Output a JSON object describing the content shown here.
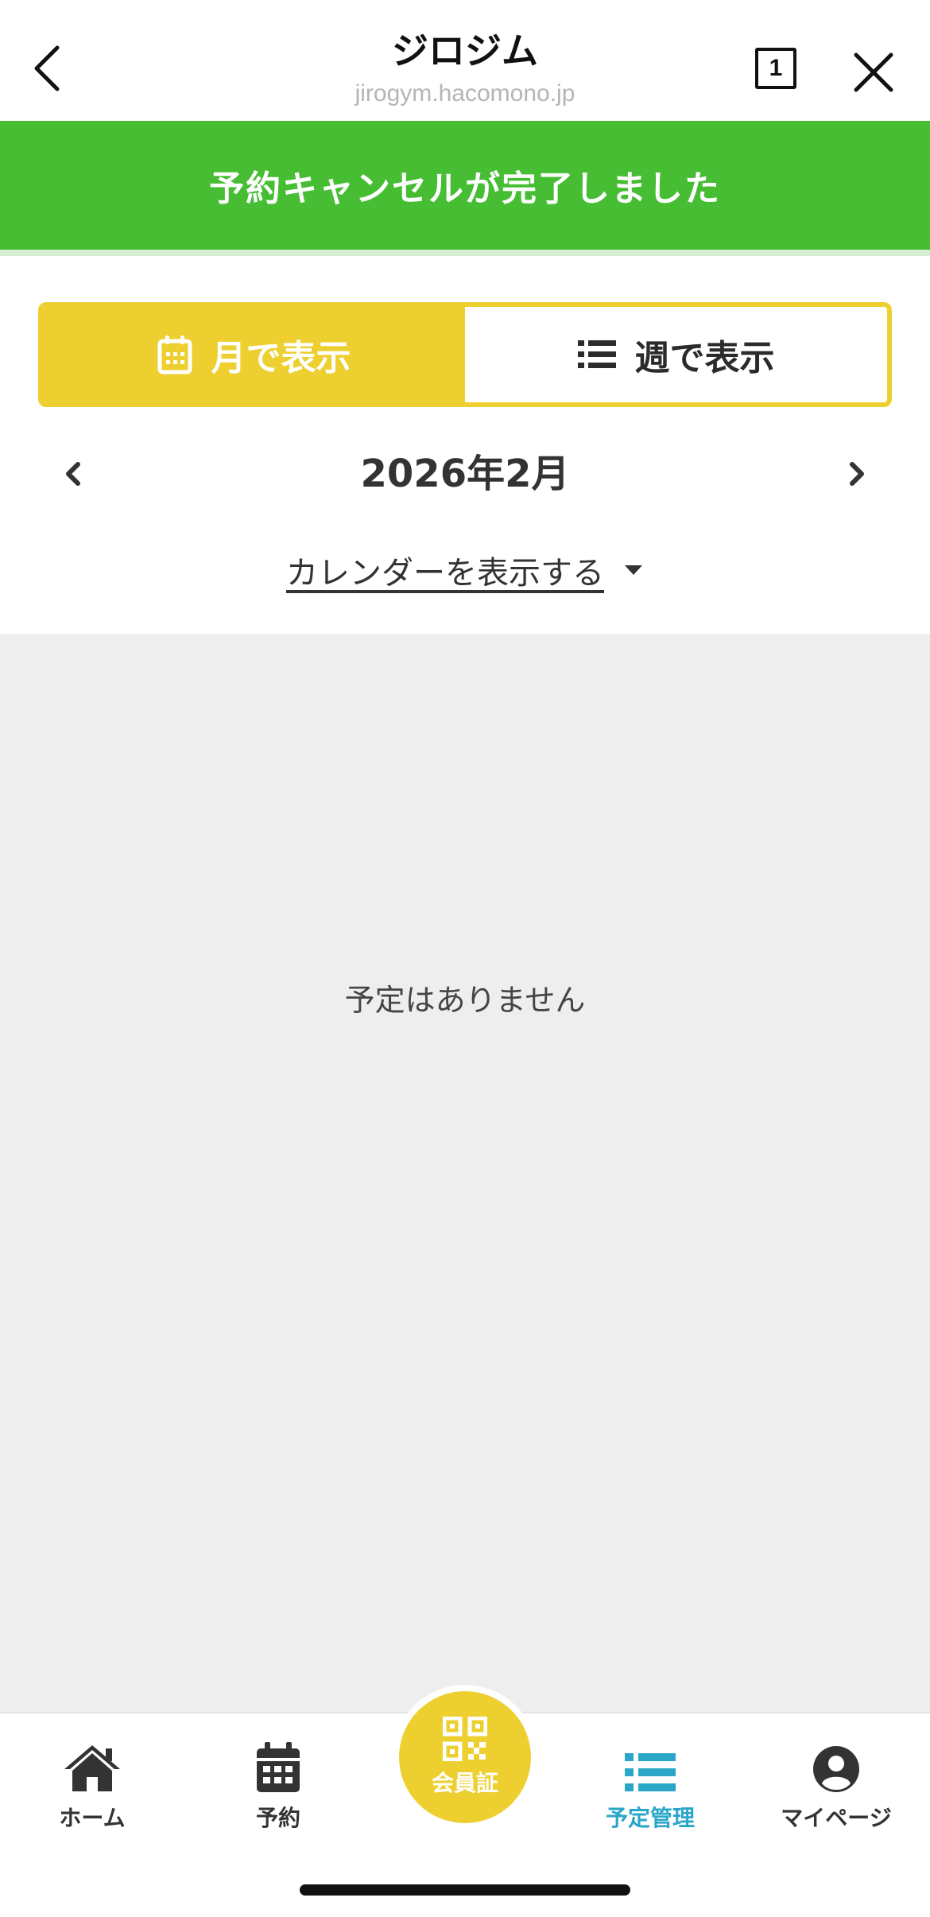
{
  "browser": {
    "title": "ジロジム",
    "url": "jirogym.hacomono.jp",
    "tab_count": "1"
  },
  "banner": {
    "message": "予約キャンセルが完了しました",
    "color": "#47bd34"
  },
  "view_toggle": {
    "month_label": "月で表示",
    "week_label": "週で表示",
    "active": "month",
    "accent_color": "#edcf30"
  },
  "month_nav": {
    "label": "2026年2月"
  },
  "calendar_toggle": {
    "label": "カレンダーを表示する"
  },
  "schedule": {
    "empty_message": "予定はありません"
  },
  "bottom_nav": {
    "items": [
      {
        "label": "ホーム",
        "icon": "home-icon"
      },
      {
        "label": "予約",
        "icon": "calendar-icon"
      },
      {
        "label": "会員証",
        "icon": "qr-code-icon"
      },
      {
        "label": "予定管理",
        "icon": "list-icon",
        "selected": true
      },
      {
        "label": "マイページ",
        "icon": "user-icon"
      }
    ],
    "selected_color": "#2aa6c9"
  }
}
